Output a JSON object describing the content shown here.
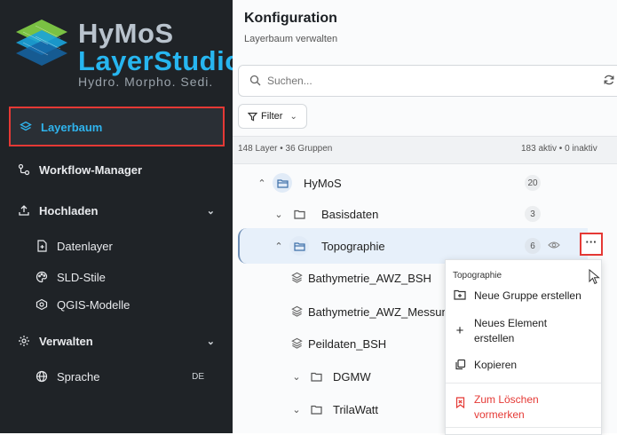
{
  "app": {
    "logo_line1": "HyMoS",
    "logo_line2": "LayerStudio",
    "logo_tagline": "Hydro. Morpho. Sedi."
  },
  "sidebar": {
    "items": [
      {
        "label": "Layerbaum",
        "icon": "layers-icon",
        "active": true
      },
      {
        "label": "Workflow-Manager",
        "icon": "workflow-icon"
      },
      {
        "label": "Hochladen",
        "icon": "upload-icon",
        "expanded": true
      },
      {
        "label": "Datenlayer",
        "icon": "file-plus-icon"
      },
      {
        "label": "SLD-Stile",
        "icon": "palette-icon"
      },
      {
        "label": "QGIS-Modelle",
        "icon": "qgis-icon"
      },
      {
        "label": "Verwalten",
        "icon": "settings-icon",
        "expanded": true
      },
      {
        "label": "Sprache",
        "icon": "globe-icon",
        "value": "DE"
      }
    ]
  },
  "header": {
    "title": "Konfiguration",
    "subtitle": "Layerbaum verwalten"
  },
  "search": {
    "placeholder": "Suchen..."
  },
  "filter": {
    "label": "Filter"
  },
  "stats": {
    "left": "148 Layer • 36 Gruppen",
    "right": "183 aktiv • 0 inaktiv"
  },
  "tree": {
    "nodes": [
      {
        "label": "HyMoS",
        "count": "20",
        "expanded": true
      },
      {
        "label": "Basisdaten",
        "count": "3",
        "expanded": false
      },
      {
        "label": "Topographie",
        "count": "6",
        "expanded": true,
        "selected": true
      },
      {
        "label": "Bathymetrie_AWZ_BSH"
      },
      {
        "label": "Bathymetrie_AWZ_Messungen"
      },
      {
        "label": "Peildaten_BSH"
      },
      {
        "label": "DGMW",
        "expanded": false
      },
      {
        "label": "TrilaWatt",
        "expanded": false
      }
    ],
    "more_label": "···"
  },
  "context_menu": {
    "header": "Topographie",
    "items": [
      {
        "label": "Neue Gruppe erstellen",
        "icon": "folder-plus-icon"
      },
      {
        "label_line1": "Neues Element",
        "label_line2": "erstellen",
        "icon": "plus-icon"
      },
      {
        "label": "Kopieren",
        "icon": "copy-icon"
      },
      {
        "label_line1": "Zum Löschen",
        "label_line2": "vormerken",
        "icon": "bookmark-delete-icon"
      }
    ]
  },
  "colors": {
    "sidebar_bg": "#1f2327",
    "accent": "#2fb4ee",
    "highlight_red": "#e53935",
    "selected_row": "#e7f0fa"
  }
}
